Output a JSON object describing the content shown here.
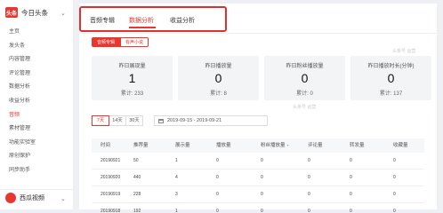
{
  "sidebar": {
    "brand": "今日头条",
    "brand_logo": "头条",
    "items": [
      {
        "label": "主页",
        "active": false
      },
      {
        "label": "发头条",
        "active": false
      },
      {
        "label": "内容管理",
        "active": false
      },
      {
        "label": "评论管理",
        "active": false
      },
      {
        "label": "数据分析",
        "active": false
      },
      {
        "label": "收益分析",
        "active": false
      },
      {
        "label": "音频",
        "active": true
      },
      {
        "label": "素材管理",
        "active": false
      },
      {
        "label": "功能实验室",
        "active": false
      },
      {
        "label": "原创保护",
        "active": false
      },
      {
        "label": "同步助手",
        "active": false
      }
    ],
    "brand2": "西瓜视频"
  },
  "tabs": [
    {
      "label": "音频专辑",
      "active": false
    },
    {
      "label": "数据分析",
      "active": true
    },
    {
      "label": "收益分析",
      "active": false
    }
  ],
  "subtabs": [
    {
      "label": "音频专辑",
      "active": true
    },
    {
      "label": "有声小说",
      "active": false
    }
  ],
  "stats": [
    {
      "label": "昨日展现量",
      "value": "1",
      "total": "累计: 233"
    },
    {
      "label": "昨日播放量",
      "value": "0",
      "total": "累计: 8"
    },
    {
      "label": "昨日粉丝播放量",
      "value": "0",
      "total": "累计: 0"
    },
    {
      "label": "昨日播放时长(分钟)",
      "value": "0",
      "total": "累计: 137"
    }
  ],
  "ranges": [
    {
      "label": "7天",
      "active": true
    },
    {
      "label": "14天",
      "active": false
    },
    {
      "label": "30天",
      "active": false
    }
  ],
  "date_range": "2019-09-15 - 2019-09-21",
  "table": {
    "headers": [
      "时间",
      "推荐量",
      "展示量",
      "播放量",
      "粉丝播放量",
      "评论量",
      "转发量",
      "收藏量"
    ],
    "rows": [
      [
        "20190921",
        "50",
        "1",
        "0",
        "0",
        "0",
        "0",
        "0"
      ],
      [
        "20190920",
        "440",
        "4",
        "0",
        "0",
        "0",
        "0",
        "0"
      ],
      [
        "20190919",
        "228",
        "3",
        "0",
        "0",
        "0",
        "0",
        "0"
      ],
      [
        "20190918",
        "192",
        "1",
        "0",
        "0",
        "0",
        "0",
        "0"
      ]
    ]
  },
  "watermark": "头条号 运营"
}
